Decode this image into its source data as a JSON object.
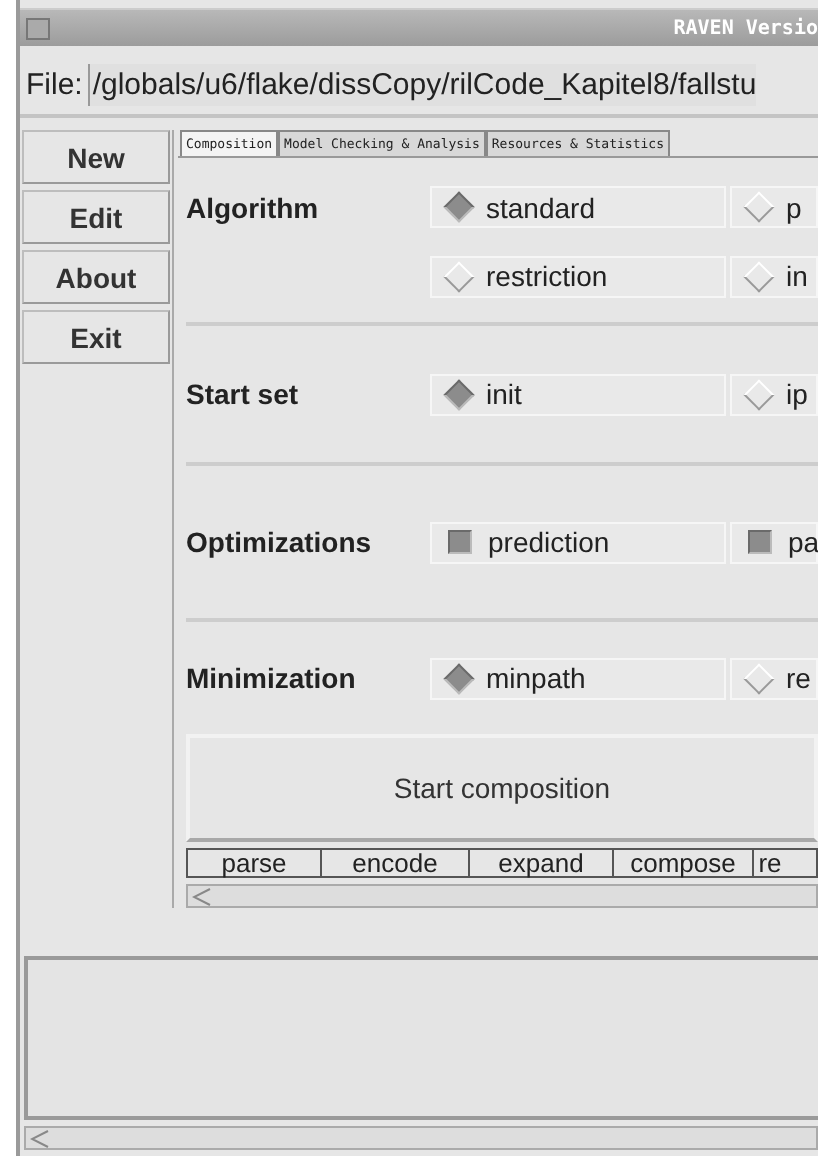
{
  "window": {
    "title": "RAVEN  Versio"
  },
  "file": {
    "label": "File:",
    "value": "/globals/u6/flake/dissCopy/rilCode_Kapitel8/fallstu"
  },
  "sidebar": {
    "buttons": [
      "New",
      "Edit",
      "About",
      "Exit"
    ]
  },
  "tabs": [
    {
      "label": "Composition",
      "selected": true
    },
    {
      "label": "Model Checking & Analysis",
      "selected": false
    },
    {
      "label": "Resources & Statistics",
      "selected": false
    }
  ],
  "sections": [
    {
      "label": "Algorithm",
      "kind": "radio",
      "options": [
        {
          "label": "standard",
          "selected": true
        },
        {
          "label": "p",
          "selected": false
        },
        {
          "label": "restriction",
          "selected": false
        },
        {
          "label": "in",
          "selected": false
        }
      ]
    },
    {
      "label": "Start set",
      "kind": "radio",
      "options": [
        {
          "label": "init",
          "selected": true
        },
        {
          "label": "ip",
          "selected": false
        }
      ]
    },
    {
      "label": "Optimizations",
      "kind": "check",
      "options": [
        {
          "label": "prediction",
          "checked": true
        },
        {
          "label": "pa",
          "checked": true
        }
      ]
    },
    {
      "label": "Minimization",
      "kind": "radio",
      "options": [
        {
          "label": "minpath",
          "selected": true
        },
        {
          "label": "re",
          "selected": false
        }
      ]
    }
  ],
  "start_button": "Start composition",
  "stages": [
    "parse",
    "encode",
    "expand",
    "compose",
    "re"
  ]
}
